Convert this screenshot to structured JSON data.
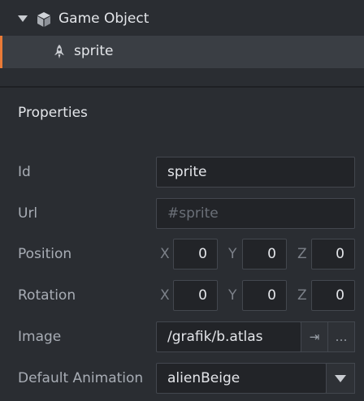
{
  "outline": {
    "root_label": "Game Object",
    "child_label": "sprite"
  },
  "properties": {
    "title": "Properties",
    "id": {
      "label": "Id",
      "value": "sprite"
    },
    "url": {
      "label": "Url",
      "placeholder": "#sprite"
    },
    "position": {
      "label": "Position",
      "x_label": "X",
      "x": "0",
      "y_label": "Y",
      "y": "0",
      "z_label": "Z",
      "z": "0"
    },
    "rotation": {
      "label": "Rotation",
      "x_label": "X",
      "x": "0",
      "y_label": "Y",
      "y": "0",
      "z_label": "Z",
      "z": "0"
    },
    "image": {
      "label": "Image",
      "value": "/grafik/b.atlas",
      "goto_glyph": "⇥",
      "browse_glyph": "…"
    },
    "default_animation": {
      "label": "Default Animation",
      "value": "alienBeige"
    }
  },
  "colors": {
    "selection_accent": "#ea7a37",
    "background": "#2a2d32",
    "field_background": "#222428"
  },
  "icons": [
    "collapse-caret-icon",
    "game-object-cube-icon",
    "sprite-rocket-icon",
    "goto-resource-icon",
    "browse-ellipsis-icon",
    "dropdown-arrow-icon"
  ]
}
